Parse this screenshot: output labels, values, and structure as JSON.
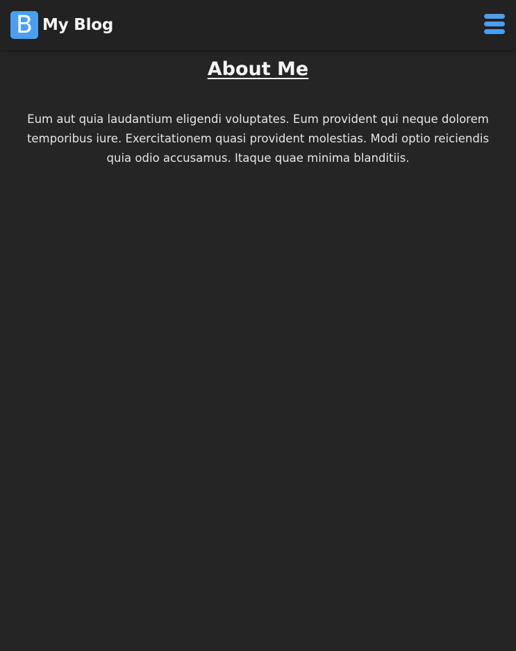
{
  "navbar": {
    "brand_letter": "B",
    "brand_name": "My Blog",
    "menu_icon": "hamburger-menu-icon",
    "accent_color": "#4a9ff0"
  },
  "main": {
    "title": "About Me",
    "paragraph": "Eum aut quia laudantium eligendi voluptates. Eum provident qui neque dolorem temporibus iure. Exercitationem quasi provident molestias. Modi optio reiciendis quia odio accusamus. Itaque quae minima blanditiis."
  },
  "colors": {
    "background": "#252525",
    "navbar": "#222222"
  }
}
